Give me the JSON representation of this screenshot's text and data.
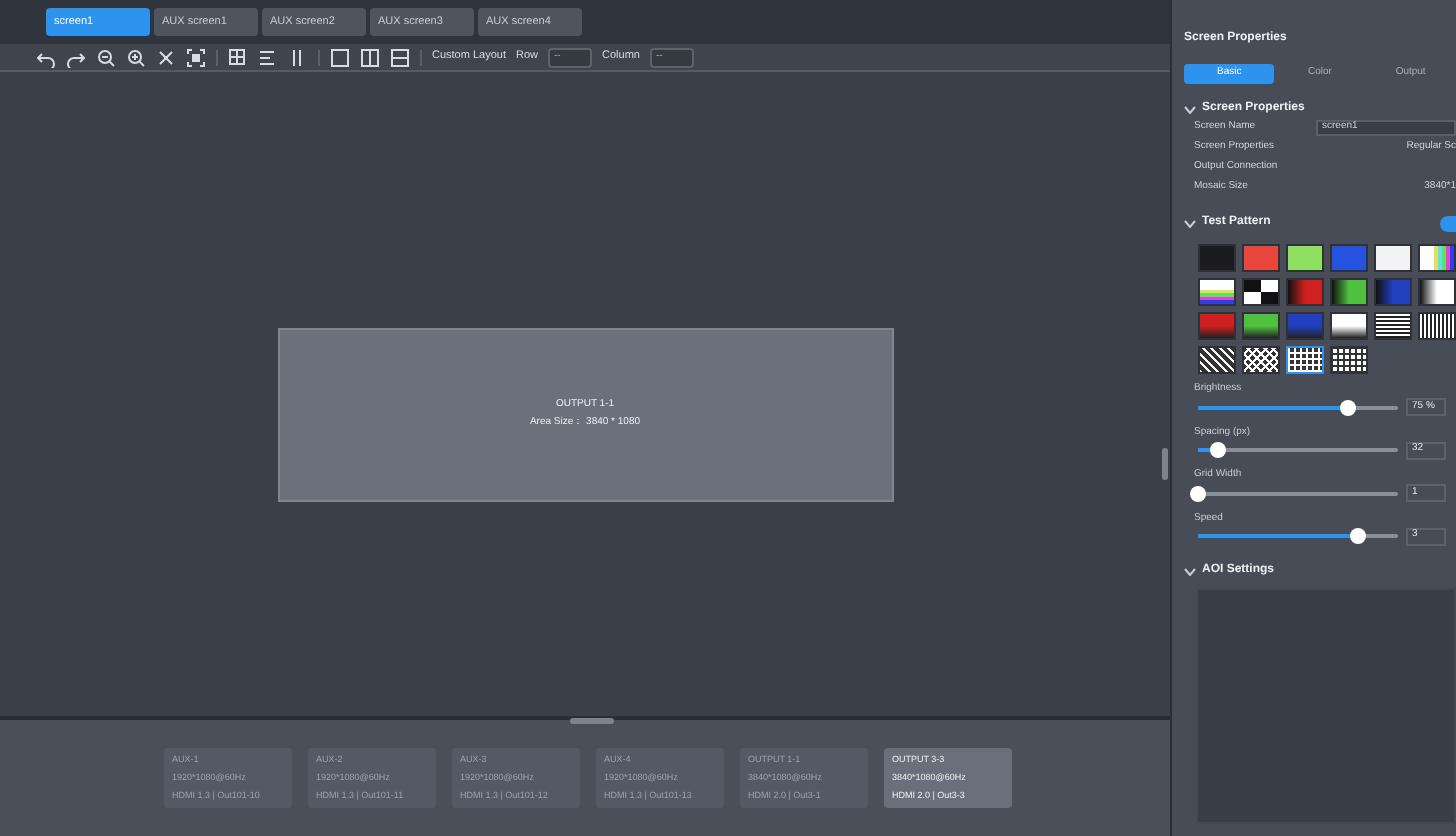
{
  "screen_tabs": [
    {
      "label": "screen1",
      "selected": true
    },
    {
      "label": "AUX screen1",
      "selected": false
    },
    {
      "label": "AUX screen2",
      "selected": false
    },
    {
      "label": "AUX screen3",
      "selected": false
    },
    {
      "label": "AUX screen4",
      "selected": false
    }
  ],
  "toolbar": {
    "custom_layout_label": "Custom Layout",
    "row_label": "Row",
    "row_value": "--",
    "column_label": "Column",
    "column_value": "--"
  },
  "canvas": {
    "output_title": "OUTPUT 1-1",
    "area_size": "Area Size： 3840 * 1080"
  },
  "output_cards": [
    {
      "name": "AUX-1",
      "resolution": "1920*1080@60Hz",
      "port": "HDMI 1.3 | Out101-10",
      "selected": false
    },
    {
      "name": "AUX-2",
      "resolution": "1920*1080@60Hz",
      "port": "HDMI 1.3 | Out101-11",
      "selected": false
    },
    {
      "name": "AUX-3",
      "resolution": "1920*1080@60Hz",
      "port": "HDMI 1.3 | Out101-12",
      "selected": false
    },
    {
      "name": "AUX-4",
      "resolution": "1920*1080@60Hz",
      "port": "HDMI 1.3 | Out101-13",
      "selected": false
    },
    {
      "name": "OUTPUT 1-1",
      "resolution": "3840*1080@60Hz",
      "port": "HDMI 2.0 | Out3-1",
      "selected": false
    },
    {
      "name": "OUTPUT 3-3",
      "resolution": "3840*1080@60Hz",
      "port": "HDMI 2.0 | Out3-3",
      "selected": true
    }
  ],
  "panel": {
    "title": "Screen Properties",
    "tabs": [
      {
        "label": "Basic",
        "selected": true
      },
      {
        "label": "Color",
        "selected": false
      },
      {
        "label": "Output",
        "selected": false
      }
    ],
    "screen_properties": {
      "heading": "Screen Properties",
      "expanded": true,
      "rows": [
        {
          "label": "Screen Name",
          "kind": "input",
          "value": "screen1"
        },
        {
          "label": "Screen Properties",
          "kind": "text",
          "value": "Regular Sc"
        },
        {
          "label": "Output Connection",
          "kind": "text"
        },
        {
          "label": "Mosaic Size",
          "kind": "text",
          "value": "3840*1"
        }
      ]
    },
    "test_pattern": {
      "heading": "Test Pattern",
      "expanded": true,
      "on": true,
      "patterns": [
        {
          "kind": "solid",
          "color": "#1c1c1e",
          "selected": false
        },
        {
          "kind": "solid",
          "color": "#e8473d",
          "selected": false
        },
        {
          "kind": "solid",
          "color": "#8fe060",
          "selected": false
        },
        {
          "kind": "solid",
          "color": "#2553e0",
          "selected": false
        },
        {
          "kind": "solid",
          "color": "#f4f4f4",
          "selected": false
        },
        {
          "kind": "bars",
          "color": "#ffffff",
          "selected": false
        },
        {
          "kind": "hbars",
          "color": "#ffffff",
          "selected": false
        },
        {
          "kind": "checker",
          "color": "#ffffff",
          "selected": false
        },
        {
          "kind": "hgradient",
          "color": "#d02020",
          "selected": false
        },
        {
          "kind": "hgradient",
          "color": "#4fc040",
          "selected": false
        },
        {
          "kind": "hgradient",
          "color": "#2040c0",
          "selected": false
        },
        {
          "kind": "hgradient",
          "color": "#ffffff",
          "selected": false
        },
        {
          "kind": "vgradient",
          "color": "#d02020",
          "selected": false
        },
        {
          "kind": "vgradient",
          "color": "#4fc040",
          "selected": false
        },
        {
          "kind": "vgradient",
          "color": "#2040c0",
          "selected": false
        },
        {
          "kind": "vgradient",
          "color": "#ffffff",
          "selected": false
        },
        {
          "kind": "hlines",
          "color": "#ffffff",
          "selected": false
        },
        {
          "kind": "vlines",
          "color": "#ffffff",
          "selected": false
        },
        {
          "kind": "hatch",
          "color": "#ffffff",
          "selected": false
        },
        {
          "kind": "crosshatch",
          "color": "#ffffff",
          "selected": false
        },
        {
          "kind": "grid",
          "color": "#ffffff",
          "selected": true
        },
        {
          "kind": "dots",
          "color": "#ffffff",
          "selected": false
        }
      ],
      "sliders": [
        {
          "label": "Brightness",
          "level": 0.75,
          "reading": "75 %"
        },
        {
          "label": "Spacing (px)",
          "level": 0.1,
          "reading": "32"
        },
        {
          "label": "Grid Width",
          "level": 0.0,
          "reading": "1"
        },
        {
          "label": "Speed",
          "level": 0.8,
          "reading": "3"
        }
      ]
    },
    "aoi_settings": {
      "heading": "AOI Settings",
      "expanded": true
    }
  }
}
